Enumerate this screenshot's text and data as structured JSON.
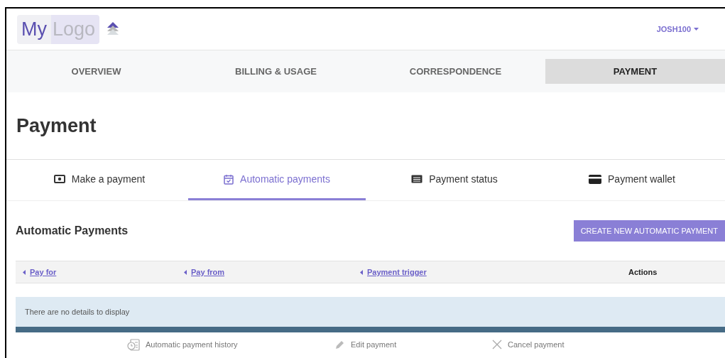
{
  "logo": {
    "word_1": "My",
    "word_2": "Logo"
  },
  "user_menu": {
    "label": "JOSH100"
  },
  "nav": [
    {
      "label": "OVERVIEW",
      "selected": false
    },
    {
      "label": "BILLING & USAGE",
      "selected": false
    },
    {
      "label": "CORRESPONDENCE",
      "selected": false
    },
    {
      "label": "PAYMENT",
      "selected": true
    }
  ],
  "page_title": "Payment",
  "subtabs": [
    {
      "label": "Make a payment",
      "kind": "cash",
      "selected": false
    },
    {
      "label": "Automatic payments",
      "kind": "calendar",
      "selected": true
    },
    {
      "label": "Payment status",
      "kind": "list",
      "selected": false
    },
    {
      "label": "Payment wallet",
      "kind": "card",
      "selected": false
    }
  ],
  "section": {
    "title": "Automatic Payments",
    "button": "CREATE NEW AUTOMATIC PAYMENT"
  },
  "table": {
    "columns": [
      {
        "label": "Pay for",
        "kind": "sortable"
      },
      {
        "label": "Pay from",
        "kind": "sortable"
      },
      {
        "label": "Payment trigger",
        "kind": "sortable"
      },
      {
        "label": "Actions",
        "kind": "plain"
      }
    ],
    "empty_message": "There are no details to display"
  },
  "actions": [
    {
      "label": "Automatic payment history",
      "kind": "history"
    },
    {
      "label": "Edit payment",
      "kind": "edit"
    },
    {
      "label": "Cancel payment",
      "kind": "cancel"
    }
  ]
}
